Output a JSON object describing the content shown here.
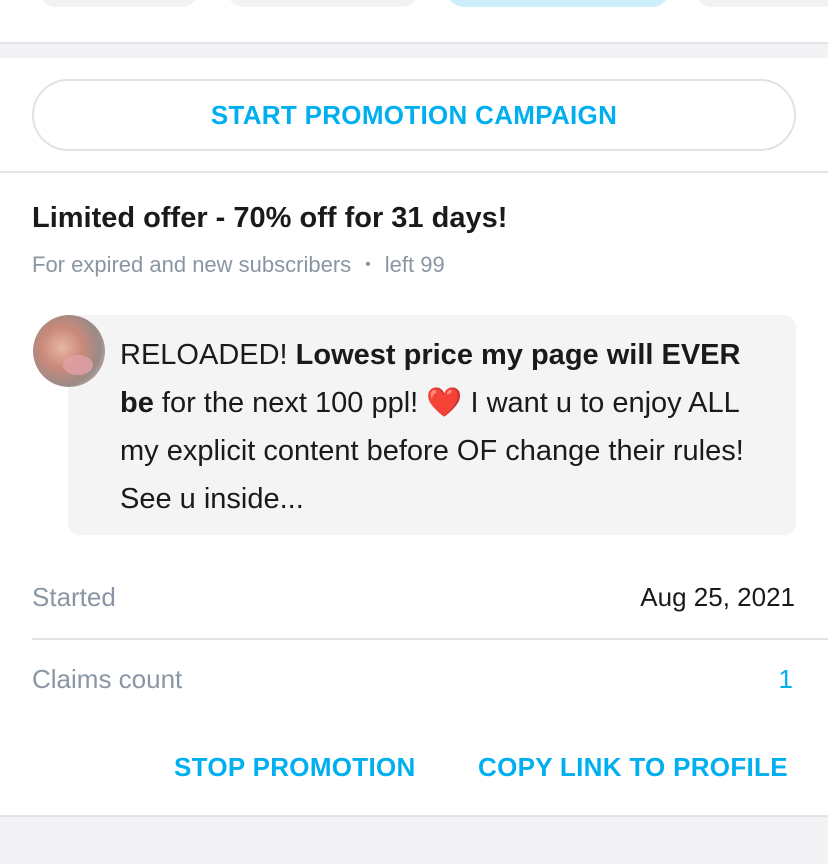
{
  "promotion": {
    "start_label": "START PROMOTION CAMPAIGN"
  },
  "offer": {
    "title": "Limited offer - 70% off for 31 days!",
    "audience": "For expired and new subscribers",
    "separator": "•",
    "remaining": "left 99",
    "message_intro": "RELOADED! ",
    "message_bold": "Lowest price my page will EVER be",
    "message_mid": " for the next 100 ppl! ",
    "message_emoji": "❤️",
    "message_end": " I want u to enjoy ALL my explicit content before OF change their rules! See u inside...",
    "started_label": "Started",
    "started_value": "Aug 25, 2021",
    "claims_label": "Claims count",
    "claims_value": "1"
  },
  "actions": {
    "stop_label": "STOP PROMOTION",
    "copy_label": "COPY LINK TO PROFILE"
  },
  "colors": {
    "accent": "#00aff0",
    "muted": "#8a96a3",
    "heart": "#e0142c"
  }
}
